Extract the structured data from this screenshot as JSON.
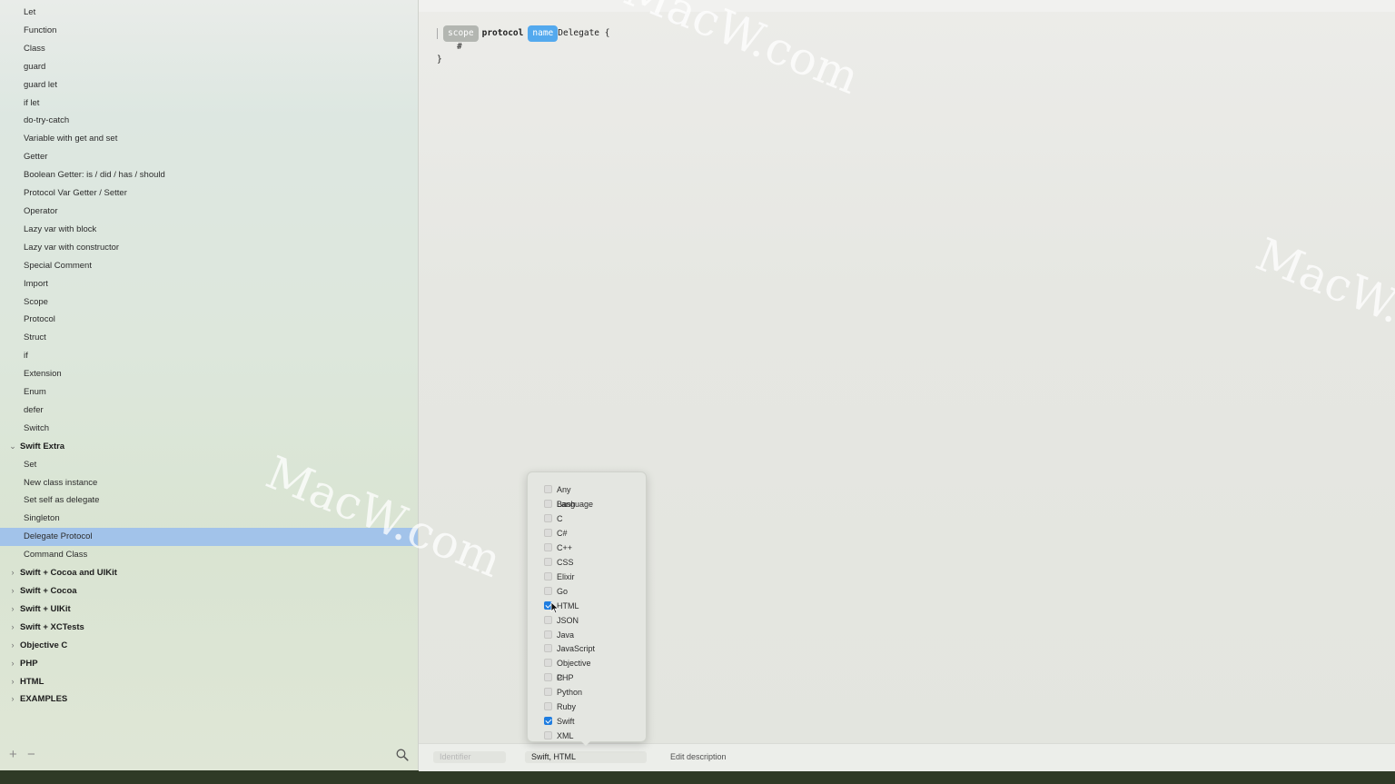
{
  "sidebar": {
    "items": [
      {
        "label": "Let",
        "type": "item"
      },
      {
        "label": "Function",
        "type": "item"
      },
      {
        "label": "Class",
        "type": "item"
      },
      {
        "label": "guard",
        "type": "item"
      },
      {
        "label": "guard let",
        "type": "item"
      },
      {
        "label": "if let",
        "type": "item"
      },
      {
        "label": "do-try-catch",
        "type": "item"
      },
      {
        "label": "Variable with get and set",
        "type": "item"
      },
      {
        "label": "Getter",
        "type": "item"
      },
      {
        "label": "Boolean Getter: is / did / has / should",
        "type": "item"
      },
      {
        "label": "Protocol Var Getter / Setter",
        "type": "item"
      },
      {
        "label": "Operator",
        "type": "item"
      },
      {
        "label": "Lazy var with block",
        "type": "item"
      },
      {
        "label": "Lazy var with constructor",
        "type": "item"
      },
      {
        "label": "Special Comment",
        "type": "item"
      },
      {
        "label": "Import",
        "type": "item"
      },
      {
        "label": "Scope",
        "type": "item"
      },
      {
        "label": "Protocol",
        "type": "item"
      },
      {
        "label": "Struct",
        "type": "item"
      },
      {
        "label": "if",
        "type": "item"
      },
      {
        "label": "Extension",
        "type": "item"
      },
      {
        "label": "Enum",
        "type": "item"
      },
      {
        "label": "defer",
        "type": "item"
      },
      {
        "label": "Switch",
        "type": "item"
      },
      {
        "label": "Swift Extra",
        "type": "group",
        "expanded": true
      },
      {
        "label": "Set",
        "type": "item"
      },
      {
        "label": "New class instance",
        "type": "item"
      },
      {
        "label": "Set self as delegate",
        "type": "item"
      },
      {
        "label": "Singleton",
        "type": "item"
      },
      {
        "label": "Delegate Protocol",
        "type": "item",
        "selected": true
      },
      {
        "label": "Command Class",
        "type": "item"
      },
      {
        "label": "Swift + Cocoa and UIKit",
        "type": "group",
        "expanded": false
      },
      {
        "label": "Swift + Cocoa",
        "type": "group",
        "expanded": false
      },
      {
        "label": "Swift + UIKit",
        "type": "group",
        "expanded": false
      },
      {
        "label": "Swift + XCTests",
        "type": "group",
        "expanded": false
      },
      {
        "label": "Objective C",
        "type": "group",
        "expanded": false
      },
      {
        "label": "PHP",
        "type": "group",
        "expanded": false
      },
      {
        "label": "HTML",
        "type": "group",
        "expanded": false
      },
      {
        "label": "EXAMPLES",
        "type": "group",
        "expanded": false
      }
    ],
    "add_label": "+",
    "remove_label": "−"
  },
  "editor": {
    "line1": {
      "token1": "scope",
      "keyword": "protocol",
      "token2": "name",
      "rest": "Delegate {"
    },
    "line2": "#",
    "line3": "}"
  },
  "bottombar": {
    "identifier_placeholder": "Identifier",
    "languages_value": "Swift, HTML",
    "description_placeholder": "Edit description"
  },
  "language_menu": {
    "options": [
      {
        "label": "Any Language",
        "checked": false
      },
      {
        "label": "Bash",
        "checked": false
      },
      {
        "label": "C",
        "checked": false
      },
      {
        "label": "C#",
        "checked": false
      },
      {
        "label": "C++",
        "checked": false
      },
      {
        "label": "CSS",
        "checked": false
      },
      {
        "label": "Elixir",
        "checked": false
      },
      {
        "label": "Go",
        "checked": false
      },
      {
        "label": "HTML",
        "checked": true
      },
      {
        "label": "JSON",
        "checked": false
      },
      {
        "label": "Java",
        "checked": false
      },
      {
        "label": "JavaScript",
        "checked": false
      },
      {
        "label": "Objective C",
        "checked": false
      },
      {
        "label": "PHP",
        "checked": false
      },
      {
        "label": "Python",
        "checked": false
      },
      {
        "label": "Ruby",
        "checked": false
      },
      {
        "label": "Swift",
        "checked": true
      },
      {
        "label": "XML",
        "checked": false
      }
    ]
  },
  "watermark": "MacW.com",
  "colors": {
    "selection": "#a2c3ea",
    "token_name": "#53a9ee",
    "token_scope": "#b3b6b1",
    "checkbox_on": "#1f7de0"
  }
}
